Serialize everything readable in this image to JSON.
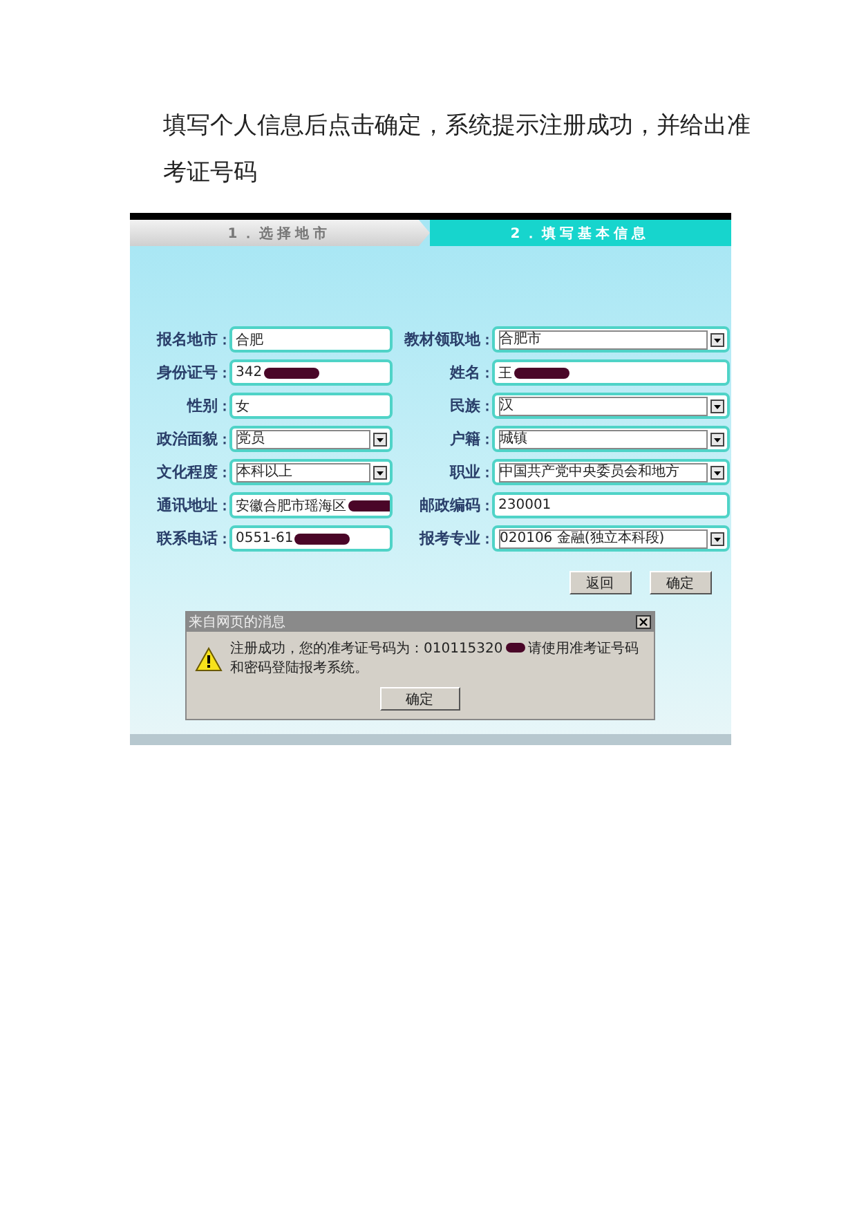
{
  "intro": "填写个人信息后点击确定，系统提示注册成功，并给出准考证号码",
  "steps": [
    {
      "label": "1．选择地市",
      "selected": false
    },
    {
      "label": "2．填写基本信息",
      "selected": true
    }
  ],
  "form": {
    "rows": [
      {
        "left": {
          "label": "报名地市",
          "colon": "：",
          "value": "合肥",
          "kind": "text",
          "redacted": false
        },
        "right": {
          "label": "教材领取地",
          "colon": "：",
          "value": "合肥市",
          "kind": "select",
          "redacted": false
        }
      },
      {
        "left": {
          "label": "身份证号",
          "colon": "：",
          "value": "342",
          "kind": "text",
          "redacted": true
        },
        "right": {
          "label": "姓名",
          "colon": "：",
          "value": "王",
          "kind": "text",
          "redacted": true
        }
      },
      {
        "left": {
          "label": "性别",
          "colon": "：",
          "value": "女",
          "kind": "text",
          "redacted": false
        },
        "right": {
          "label": "民族",
          "colon": "：",
          "value": "汉",
          "kind": "select",
          "redacted": false
        }
      },
      {
        "left": {
          "label": "政治面貌",
          "colon": "：",
          "value": "党员",
          "kind": "select",
          "redacted": false
        },
        "right": {
          "label": "户籍",
          "colon": "：",
          "value": "城镇",
          "kind": "select",
          "redacted": false
        }
      },
      {
        "left": {
          "label": "文化程度",
          "colon": "：",
          "value": "本科以上",
          "kind": "select",
          "redacted": false
        },
        "right": {
          "label": "职业",
          "colon": "：",
          "value": "中国共产党中央委员会和地方",
          "kind": "select",
          "redacted": false
        }
      },
      {
        "left": {
          "label": "通讯地址",
          "colon": "：",
          "value": "安徽合肥市瑶海区",
          "kind": "text",
          "redacted": true
        },
        "right": {
          "label": "邮政编码",
          "colon": "：",
          "value": "230001",
          "kind": "text",
          "redacted": false
        }
      },
      {
        "left": {
          "label": "联系电话",
          "colon": "：",
          "value": "0551-61",
          "kind": "text",
          "redacted": true
        },
        "right": {
          "label": "报考专业",
          "colon": "：",
          "value": "020106 金融(独立本科段)",
          "kind": "select",
          "redacted": false
        }
      }
    ]
  },
  "buttons": [
    "返回",
    "确定"
  ],
  "dialog": {
    "title": "来自网页的消息",
    "message_start": "注册成功，您的准考证号码为：010115320",
    "message_end": "请使用准考证号码和密码登陆报考系统。",
    "button": "确定"
  }
}
